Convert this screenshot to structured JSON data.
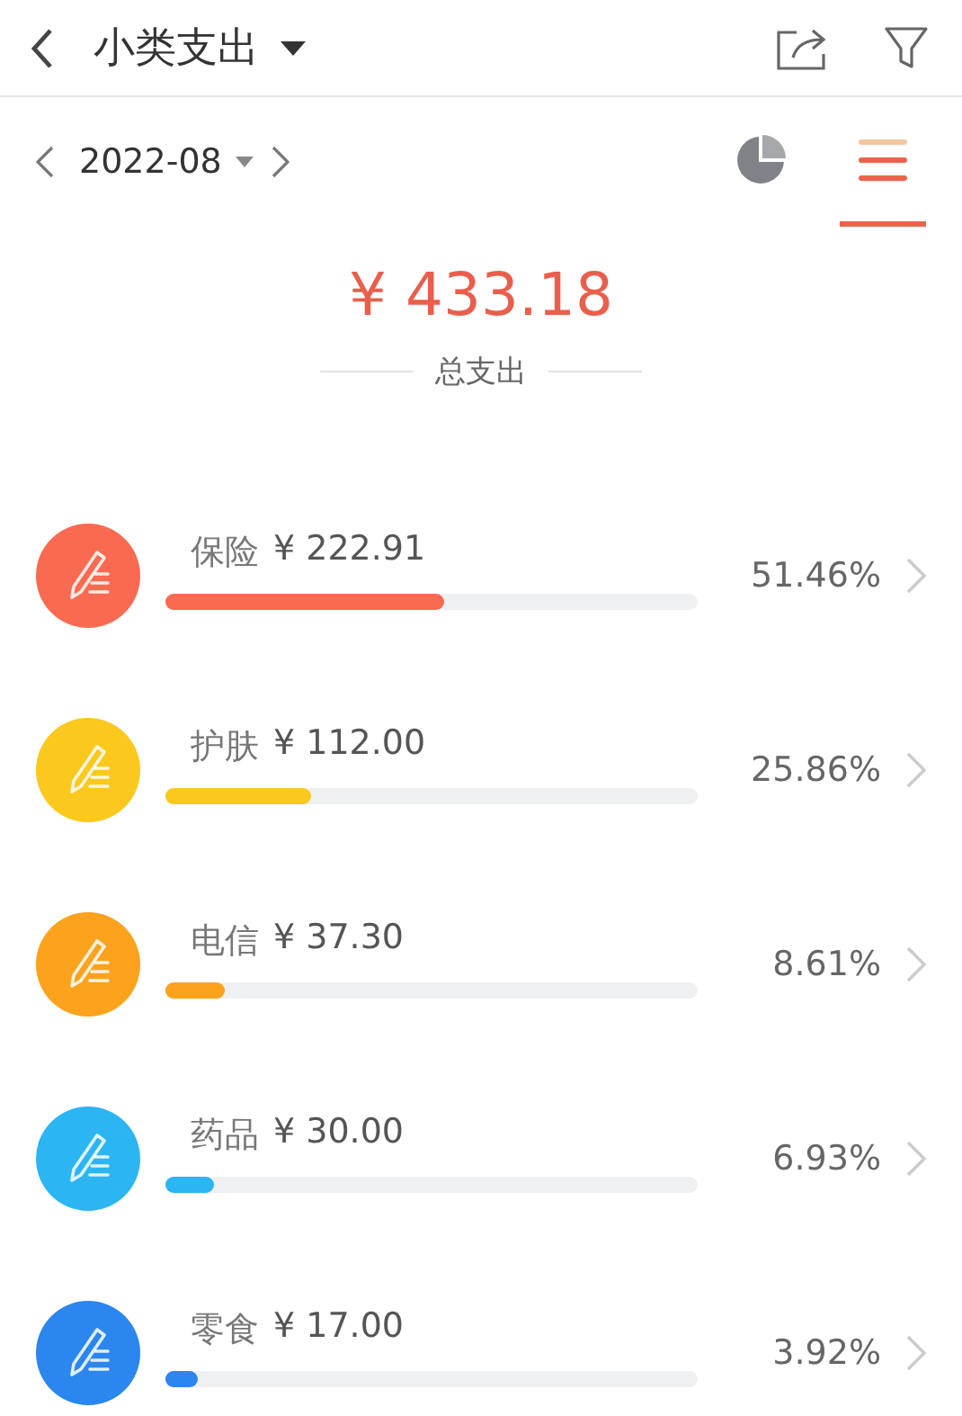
{
  "header": {
    "title": "小类支出"
  },
  "period": {
    "month": "2022-08"
  },
  "views": [
    {
      "kind": "pie",
      "selected": false
    },
    {
      "kind": "list",
      "selected": true
    }
  ],
  "summary": {
    "total": "¥ 433.18",
    "label": "总支出"
  },
  "categories": [
    {
      "name": "保险",
      "amount": "¥ 222.91",
      "percent": "51.46%",
      "level": 0.525,
      "color": "#fa6a50"
    },
    {
      "name": "护肤",
      "amount": "¥ 112.00",
      "percent": "25.86%",
      "level": 0.275,
      "color": "#fbc81e"
    },
    {
      "name": "电信",
      "amount": "¥ 37.30",
      "percent": "8.61%",
      "level": 0.11,
      "color": "#fca21c"
    },
    {
      "name": "药品",
      "amount": "¥ 30.00",
      "percent": "6.93%",
      "level": 0.09,
      "color": "#2bb5f3"
    },
    {
      "name": "零食",
      "amount": "¥ 17.00",
      "percent": "3.92%",
      "level": 0.06,
      "color": "#2b86ee"
    }
  ]
}
